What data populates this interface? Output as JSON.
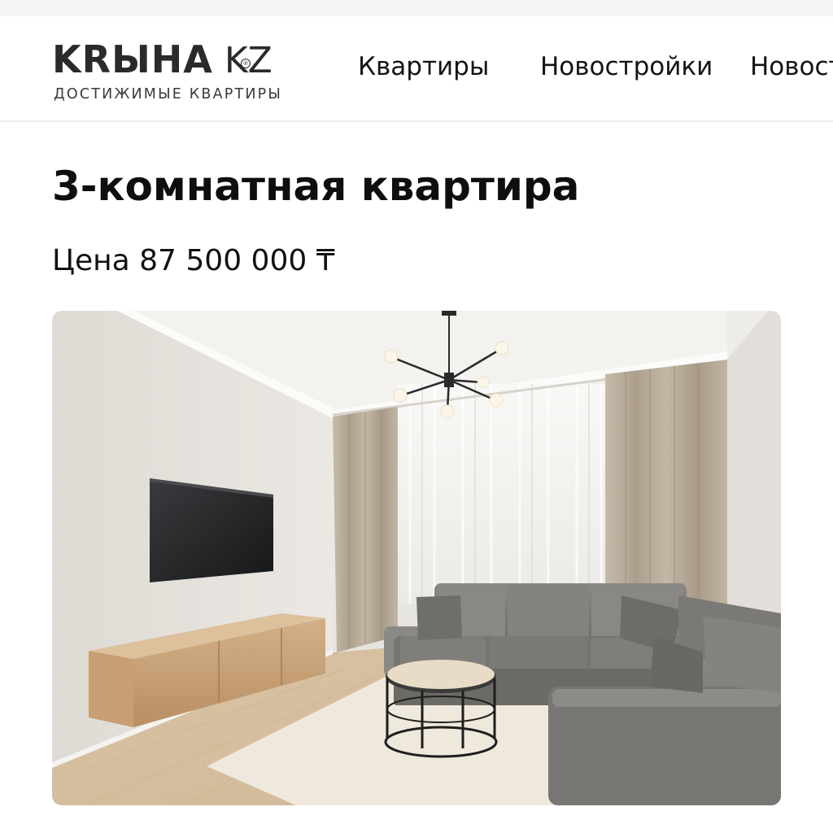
{
  "header": {
    "logo": {
      "name_bold": "KRЫНА",
      "registered_mark": "®",
      "name_suffix": "KZ",
      "tagline": "ДОСТИЖИМЫЕ КВАРТИРЫ"
    },
    "nav": [
      {
        "label": "Квартиры"
      },
      {
        "label": "Новостройки"
      },
      {
        "label": "Новост"
      }
    ]
  },
  "listing": {
    "title": "3-комнатная квартира",
    "price": "Цена 87 500 000 ₸",
    "photo": {
      "description_icon": "living-room-photo"
    }
  },
  "colors": {
    "accent_text": "#111111",
    "header_border": "#ececec",
    "wall": "#e4e1dc",
    "curtain": "#bdb09e",
    "sofa": "#7d7b78",
    "wood": "#c9a57a",
    "floor": "#d8c3a4"
  }
}
